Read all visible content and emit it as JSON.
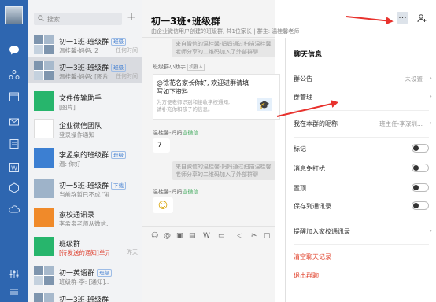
{
  "search": {
    "placeholder": "搜索"
  },
  "conversations": [
    {
      "name": "初一1班-班级群",
      "tag": "班级",
      "sub": "温桂馨-妈妈: 2",
      "time": "任何时间"
    },
    {
      "name": "初一3班-班级群",
      "tag": "班级",
      "sub": "温桂馨-妈妈: [图片]",
      "time": "任何时间",
      "selected": true
    },
    {
      "name": "文件传输助手",
      "tag": "",
      "sub": "[图片]",
      "time": ""
    },
    {
      "name": "企业微信团队",
      "tag": "",
      "sub": "登录操作通知",
      "time": ""
    },
    {
      "name": "李孟泉的班级群",
      "tag": "班级",
      "sub": "温: 你好",
      "time": ""
    },
    {
      "name": "初一5班-班级群",
      "tag": "下载",
      "sub": "当前群暂已不成 \"初一...",
      "time": ""
    },
    {
      "name": "家校通讯录",
      "tag": "",
      "sub": "李孟泉老师从微信...",
      "time": ""
    },
    {
      "name": "班级群",
      "tag": "",
      "sub": "[待发送的通知]单元...",
      "time": "昨天",
      "red": true
    },
    {
      "name": "初一英语群",
      "tag": "班级",
      "sub": "班级群-李: [通知]...",
      "time": ""
    },
    {
      "name": "初一3班-班级群",
      "tag": "",
      "sub": "",
      "time": ""
    }
  ],
  "chat": {
    "title": "初一3班•班级群",
    "desc": "由企业微信用户创建的班级群, 共1位家长 | 群主: 温桂馨老师",
    "messages": {
      "sys1": "来自微信的温桂馨-妈妈通过扫描温桂馨老师分享的二维码加入了外部群聊",
      "assistant_sender": "班级群小助手",
      "assistant_badge": "机器人",
      "card_text": "@徐花名家长你好, 欢迎进群请填写如下资料",
      "card_sub": "为方便老师识别和接收学校通知, 请补充你和孩子的信息。",
      "sender1": "温桂馨-妈妈",
      "wx_suffix": "@微信",
      "bubble1": "7",
      "sys2": "来自微信的温桂馨-妈妈通过扫描温桂馨老师分享的二维码加入了外部群聊",
      "sender2": "温桂馨-妈妈",
      "bubble2": "☺"
    }
  },
  "drawer": {
    "title": "聊天信息",
    "rows": {
      "announcement": {
        "label": "群公告",
        "value": "未设置"
      },
      "management": {
        "label": "群管理"
      },
      "nickname": {
        "label": "我在本群的昵称",
        "value": "班主任-李深圳..."
      },
      "mark": {
        "label": "标记"
      },
      "mute": {
        "label": "消息免打扰"
      },
      "pin": {
        "label": "置顶"
      },
      "save": {
        "label": "保存到通讯录"
      },
      "contacts": {
        "label": "提醒加入家校通讯录"
      },
      "clear": {
        "label": "清空聊天记录"
      },
      "exit": {
        "label": "退出群聊"
      }
    }
  },
  "colors": {
    "rail": "#2e66b0",
    "accent": "#3a7ad0",
    "danger": "#e0402a",
    "annotation": "#e8322d"
  }
}
